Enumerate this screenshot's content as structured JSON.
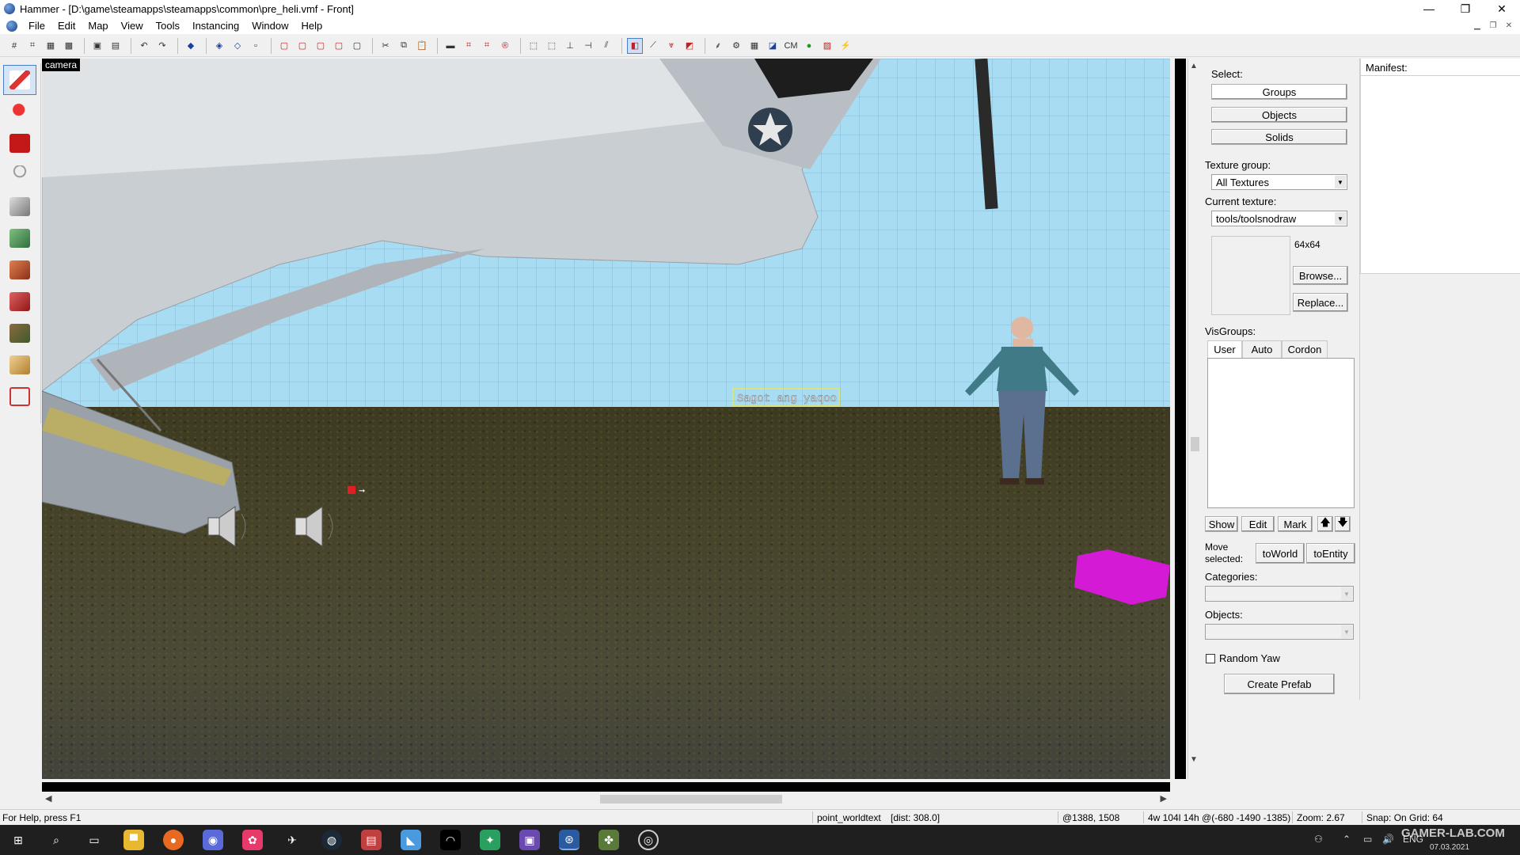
{
  "window": {
    "title": "Hammer - [D:\\game\\steamapps\\steamapps\\common\\pre_heli.vmf - Front]",
    "minimize": "—",
    "restore": "❐",
    "close": "✕"
  },
  "menu": [
    "File",
    "Edit",
    "Map",
    "View",
    "Tools",
    "Instancing",
    "Window",
    "Help"
  ],
  "viewport": {
    "label": "camera",
    "worldtext": "Sagot ang yaqoo"
  },
  "select_panel": {
    "label": "Select:",
    "groups": "Groups",
    "objects": "Objects",
    "solids": "Solids"
  },
  "texture": {
    "group_label": "Texture group:",
    "group_value": "All Textures",
    "current_label": "Current texture:",
    "current_value": "tools/toolsnodraw",
    "size": "64x64",
    "browse": "Browse...",
    "replace": "Replace..."
  },
  "visgroups": {
    "label": "VisGroups:",
    "tabs": [
      "User",
      "Auto",
      "Cordon"
    ],
    "show": "Show",
    "edit": "Edit",
    "mark": "Mark",
    "up": "🡅",
    "down": "🡇"
  },
  "move_selected": {
    "label_line1": "Move",
    "label_line2": "selected:",
    "to_world": "toWorld",
    "to_entity": "toEntity"
  },
  "prefab": {
    "categories_label": "Categories:",
    "objects_label": "Objects:",
    "random_yaw": "Random Yaw",
    "create_prefab": "Create Prefab"
  },
  "manifest": {
    "label": "Manifest:"
  },
  "status": {
    "help": "For Help, press F1",
    "entity": "point_worldtext",
    "dist": "[dist: 308.0]",
    "coords": "@1388, 1508",
    "size": "4w 104l 14h @(-680 -1490 -1385)",
    "zoom": "Zoom: 2.67",
    "snap": "Snap: On Grid: 64"
  },
  "taskbar": {
    "lang": "ENG",
    "date": "07.03.2021",
    "watermark": "GAMER-LAB.COM"
  }
}
